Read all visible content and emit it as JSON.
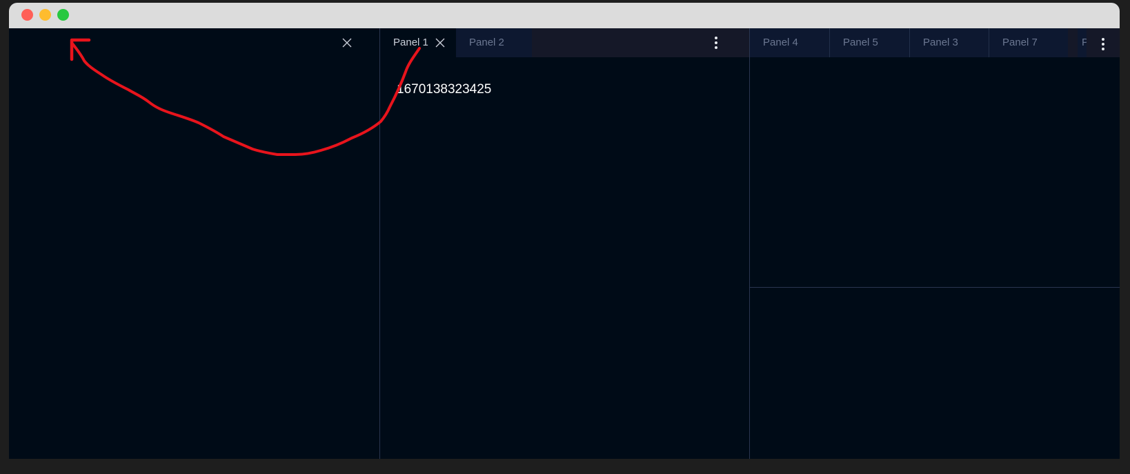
{
  "panels": {
    "group2": {
      "tabs": [
        {
          "label": "Panel 1",
          "active": true
        },
        {
          "label": "Panel 2",
          "active": false
        }
      ],
      "content_value": "1670138323425"
    },
    "group3": {
      "tabs": [
        {
          "label": "Panel 4"
        },
        {
          "label": "Panel 5"
        },
        {
          "label": "Panel 3"
        },
        {
          "label": "Panel 7"
        },
        {
          "label": "P"
        }
      ]
    }
  },
  "icons": {
    "close": "close-icon",
    "more": "more-vertical-icon"
  },
  "colors": {
    "background": "#000b17",
    "tab_inactive_text": "#6b7791",
    "tab_active_text": "#c9ced8",
    "annotation": "#e8141c"
  }
}
